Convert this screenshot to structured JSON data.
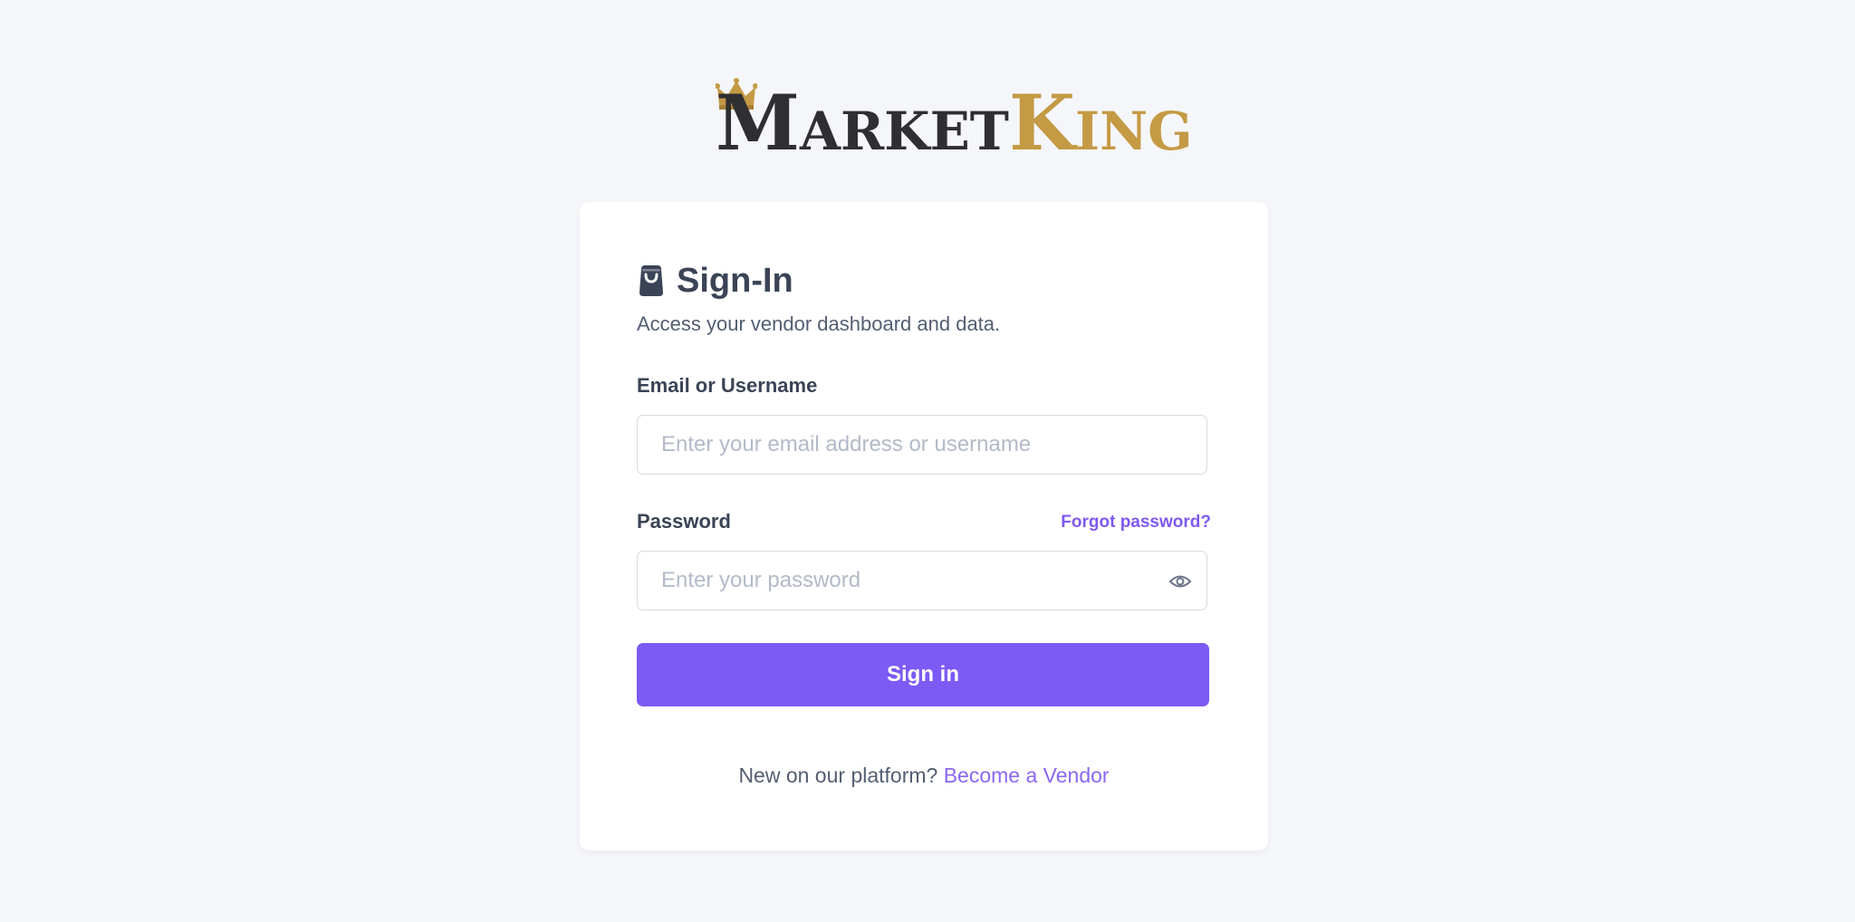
{
  "brand": {
    "name_part1": "Market",
    "name_part2": "King",
    "color_dark": "#2f2f31",
    "color_gold": "#c49a45"
  },
  "card": {
    "title": "Sign-In",
    "title_icon": "shopping-bag-icon",
    "subtitle": "Access your vendor dashboard and data."
  },
  "form": {
    "email_label": "Email or Username",
    "email_placeholder": "Enter your email address or username",
    "email_value": "",
    "password_label": "Password",
    "password_placeholder": "Enter your password",
    "password_value": "",
    "forgot_link": "Forgot password?",
    "toggle_icon": "eye-icon",
    "submit_label": "Sign in"
  },
  "footer": {
    "prompt": "New on our platform?",
    "link": "Become a Vendor"
  },
  "colors": {
    "accent": "#7c5af5",
    "background": "#f5f6f9",
    "text": "#3b4456"
  }
}
